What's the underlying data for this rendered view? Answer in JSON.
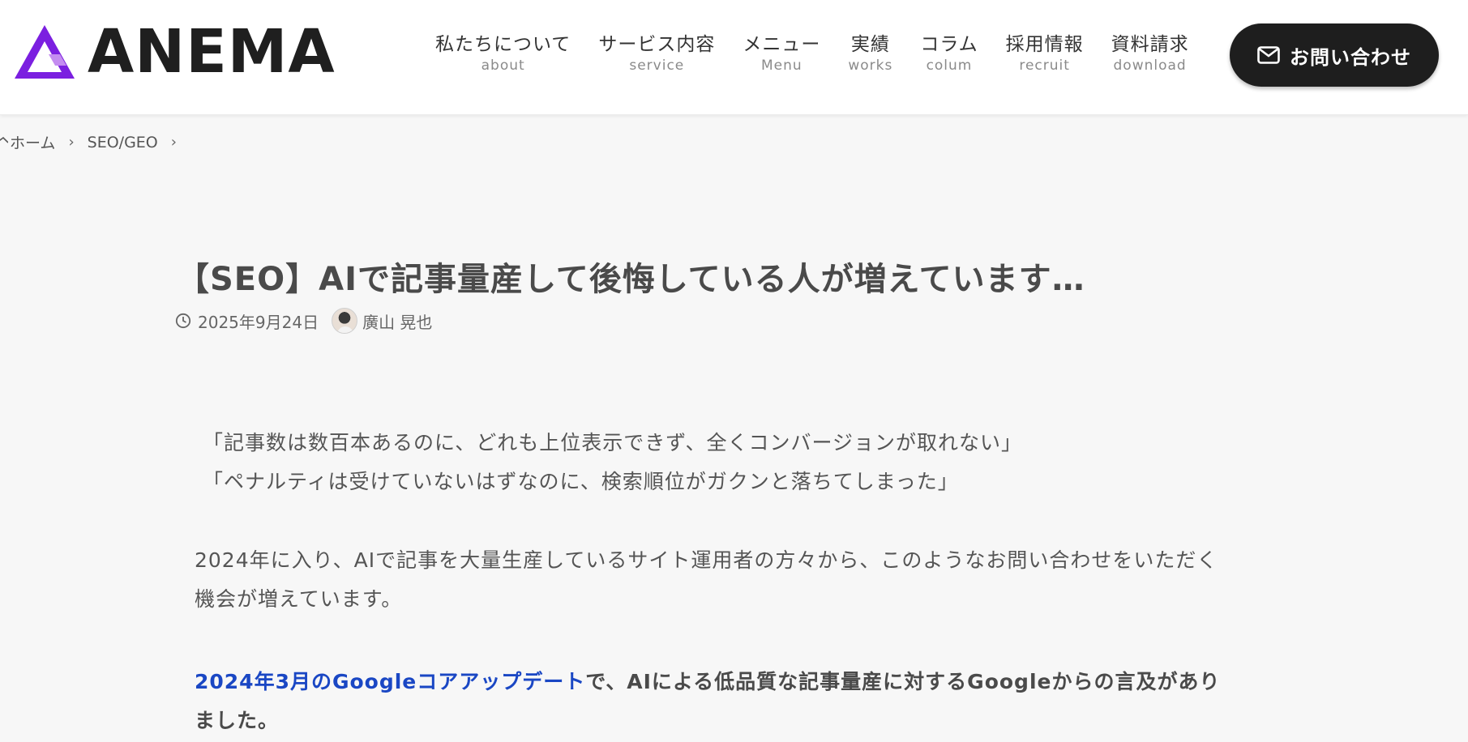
{
  "header": {
    "logo_text": "ANEMA",
    "logo_colors": {
      "primary": "#7b1fe0",
      "secondary": "#c48cf0"
    },
    "nav": [
      {
        "ja": "私たちについて",
        "en": "about"
      },
      {
        "ja": "サービス内容",
        "en": "service"
      },
      {
        "ja": "メニュー",
        "en": "Menu"
      },
      {
        "ja": "実績",
        "en": "works"
      },
      {
        "ja": "コラム",
        "en": "colum"
      },
      {
        "ja": "採用情報",
        "en": "recruit"
      },
      {
        "ja": "資料請求",
        "en": "download"
      }
    ],
    "contact_label": "お問い合わせ"
  },
  "breadcrumb": {
    "home": "ホーム",
    "category": "SEO/GEO",
    "separator": "›"
  },
  "article": {
    "title": "【SEO】AIで記事量産して後悔している人が増えています…",
    "date": "2025年9月24日",
    "author": "廣山 晃也",
    "quote1": "「記事数は数百本あるのに、どれも上位表示できず、全くコンバージョンが取れない」",
    "quote2": "「ペナルティは受けていないはずなのに、検索順位がガクンと落ちてしまった」",
    "para1": "2024年に入り、AIで記事を大量生産しているサイト運用者の方々から、このようなお問い合わせをいただく機会が増えています。",
    "para2_link": "2024年3月のGoogleコアアップデート",
    "para2_rest": "で、AIによる低品質な記事量産に対するGoogleからの言及がありました。"
  },
  "colors": {
    "link": "#1a47c4",
    "button_bg": "#1e1e1e",
    "page_bg": "#f7f7f7"
  }
}
